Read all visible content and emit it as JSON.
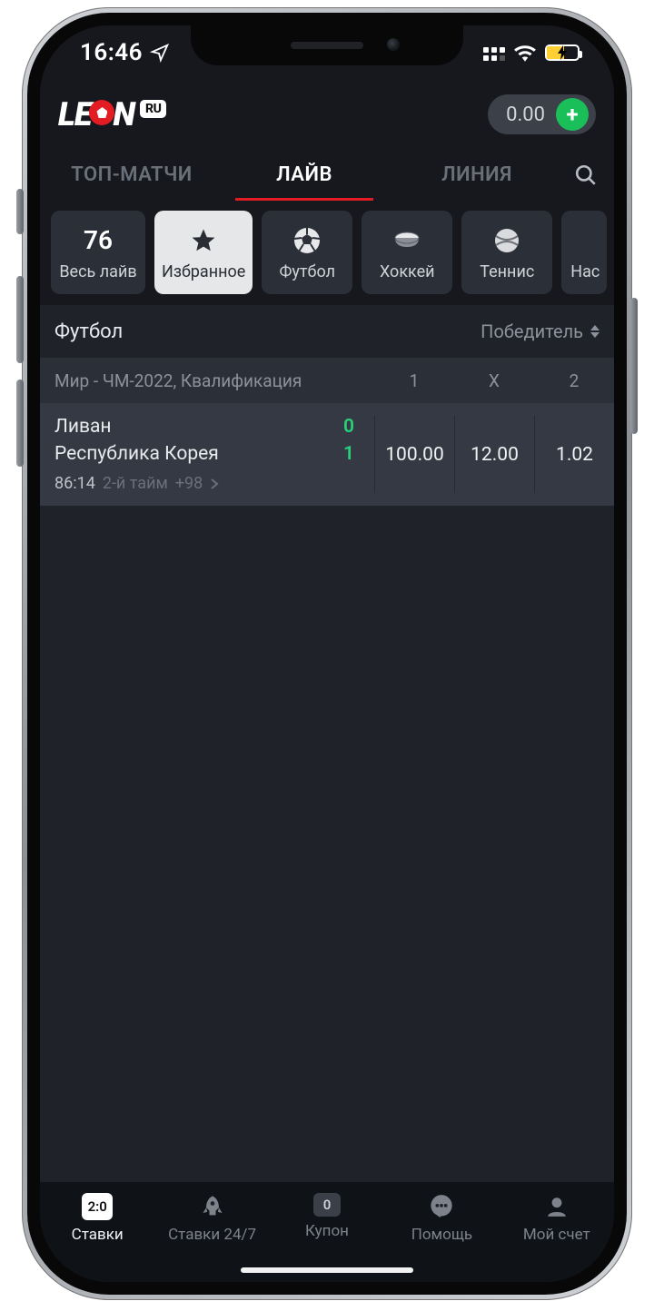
{
  "status": {
    "time": "16:46"
  },
  "header": {
    "logo_left": "LE",
    "logo_right": "N",
    "logo_badge": "RU",
    "balance": "0.00",
    "plus": "+"
  },
  "tabs": {
    "items": [
      {
        "label": "ТОП-МАТЧИ"
      },
      {
        "label": "ЛАЙВ"
      },
      {
        "label": "ЛИНИЯ"
      }
    ],
    "active_index": 1
  },
  "chips": [
    {
      "top": "76",
      "label": "Весь лайв",
      "icon": "count"
    },
    {
      "top": "star",
      "label": "Избранное",
      "icon": "star"
    },
    {
      "top": "ball",
      "label": "Футбол",
      "icon": "soccer"
    },
    {
      "top": "puck",
      "label": "Хоккей",
      "icon": "hockey"
    },
    {
      "top": "tball",
      "label": "Теннис",
      "icon": "tennis"
    },
    {
      "top": "",
      "label": "Нас",
      "icon": "none"
    }
  ],
  "section": {
    "title": "Футбол",
    "sort_label": "Победитель"
  },
  "league": {
    "name": "Мир - ЧМ-2022, Квалификация",
    "cols": [
      "1",
      "X",
      "2"
    ]
  },
  "match": {
    "team1": "Ливан",
    "score1": "0",
    "team2": "Республика Корея",
    "score2": "1",
    "clock": "86:14",
    "period": "2-й тайм",
    "more": "+98",
    "odds": [
      "100.00",
      "12.00",
      "1.02"
    ]
  },
  "bottom": {
    "items": [
      {
        "label": "Ставки",
        "icon": "score",
        "badge": "2:0"
      },
      {
        "label": "Ставки 24/7",
        "icon": "rocket"
      },
      {
        "label": "Купон",
        "icon": "badge",
        "badge": "0"
      },
      {
        "label": "Помощь",
        "icon": "chat"
      },
      {
        "label": "Мой счет",
        "icon": "user"
      }
    ],
    "active_index": 0
  }
}
